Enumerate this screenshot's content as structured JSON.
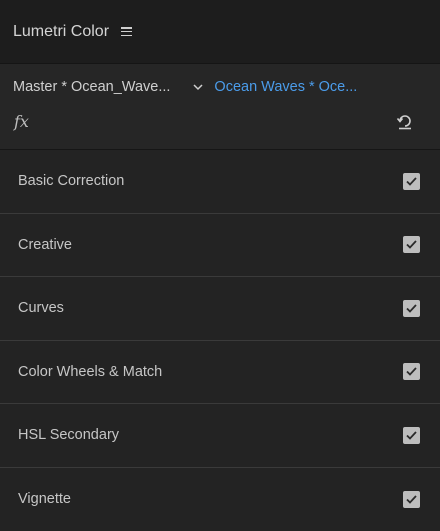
{
  "panel": {
    "title": "Lumetri Color",
    "master_clip": "Master * Ocean_Wave...",
    "sequence_clip": "Ocean Waves * Oce...",
    "fx_label": "fx"
  },
  "sections": [
    {
      "label": "Basic Correction",
      "enabled": true
    },
    {
      "label": "Creative",
      "enabled": true
    },
    {
      "label": "Curves",
      "enabled": true
    },
    {
      "label": "Color Wheels & Match",
      "enabled": true
    },
    {
      "label": "HSL Secondary",
      "enabled": true
    },
    {
      "label": "Vignette",
      "enabled": true
    }
  ],
  "colors": {
    "panel_bg": "#232323",
    "accent_blue": "#4b9cea",
    "checkbox": "#bdbdbd"
  }
}
